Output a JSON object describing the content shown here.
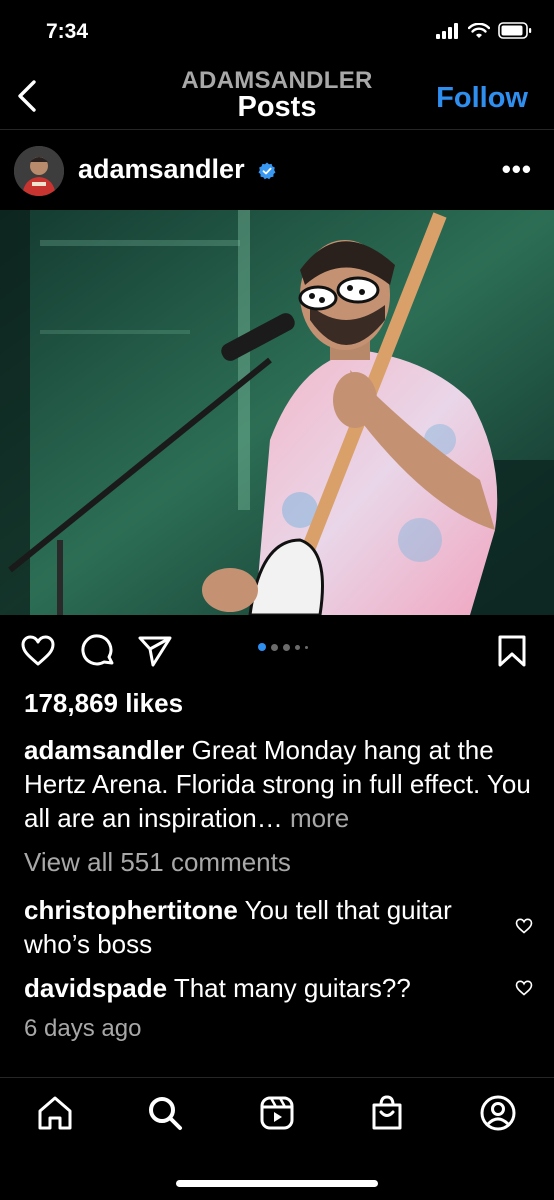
{
  "status_bar": {
    "time": "7:34"
  },
  "header": {
    "account": "ADAMSANDLER",
    "title": "Posts",
    "follow_label": "Follow"
  },
  "post": {
    "username": "adamsandler",
    "likes": "178,869 likes",
    "caption_user": "adamsandler",
    "caption_text": "Great Monday hang at the Hertz Arena. Florida strong in full effect. You all are an inspiration…",
    "more_label": "more",
    "view_all": "View all 551 comments",
    "comments": [
      {
        "user": "christophertitone",
        "text": "You tell that guitar who’s boss"
      },
      {
        "user": "davidspade",
        "text": "That many guitars??"
      }
    ],
    "time_ago": "6 days ago",
    "carousel": {
      "total": 5,
      "active_index": 0
    }
  },
  "colors": {
    "accent": "#2f8ff0",
    "muted": "#a8a8a8",
    "background": "#000000"
  },
  "icons": {
    "back": "chevron-left-icon",
    "verified": "verified-badge-icon",
    "like": "heart-icon",
    "comment": "comment-icon",
    "share": "paper-plane-icon",
    "save": "bookmark-icon",
    "nav": [
      "home-icon",
      "search-icon",
      "reels-icon",
      "shop-icon",
      "profile-icon"
    ]
  }
}
